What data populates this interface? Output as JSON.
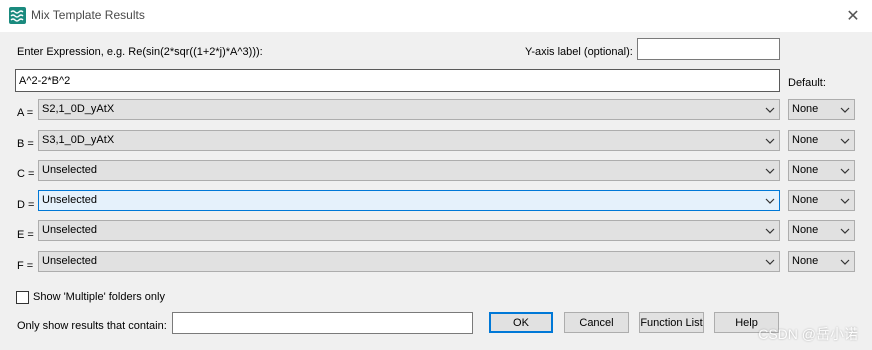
{
  "window": {
    "title": "Mix Template Results",
    "icon": "waves-app-icon",
    "close_glyph": "✕"
  },
  "expression": {
    "label": "Enter Expression, e.g. Re(sin(2*sqr((1+2*j)*A^3))):",
    "value": "A^2-2*B^2"
  },
  "yaxis": {
    "label": "Y-axis label (optional):",
    "value": ""
  },
  "default_label": "Default:",
  "rows": [
    {
      "label": "A =",
      "value": "S2,1_0D_yAtX",
      "default": "None"
    },
    {
      "label": "B =",
      "value": "S3,1_0D_yAtX",
      "default": "None"
    },
    {
      "label": "C =",
      "value": "Unselected",
      "default": "None"
    },
    {
      "label": "D =",
      "value": "Unselected",
      "default": "None"
    },
    {
      "label": "E =",
      "value": "Unselected",
      "default": "None"
    },
    {
      "label": "F =",
      "value": "Unselected",
      "default": "None"
    }
  ],
  "multiple_only": {
    "label": "Show 'Multiple' folders only",
    "checked": false
  },
  "filter": {
    "label": "Only show results that contain:",
    "value": ""
  },
  "buttons": {
    "ok": "OK",
    "cancel": "Cancel",
    "function_list": "Function List",
    "help": "Help"
  },
  "watermark": "CSDN @岳小诺",
  "colors": {
    "accent": "#0078d7",
    "focused_combo_bg": "#e5f1fb",
    "icon_bg": "#1a8a7e"
  }
}
